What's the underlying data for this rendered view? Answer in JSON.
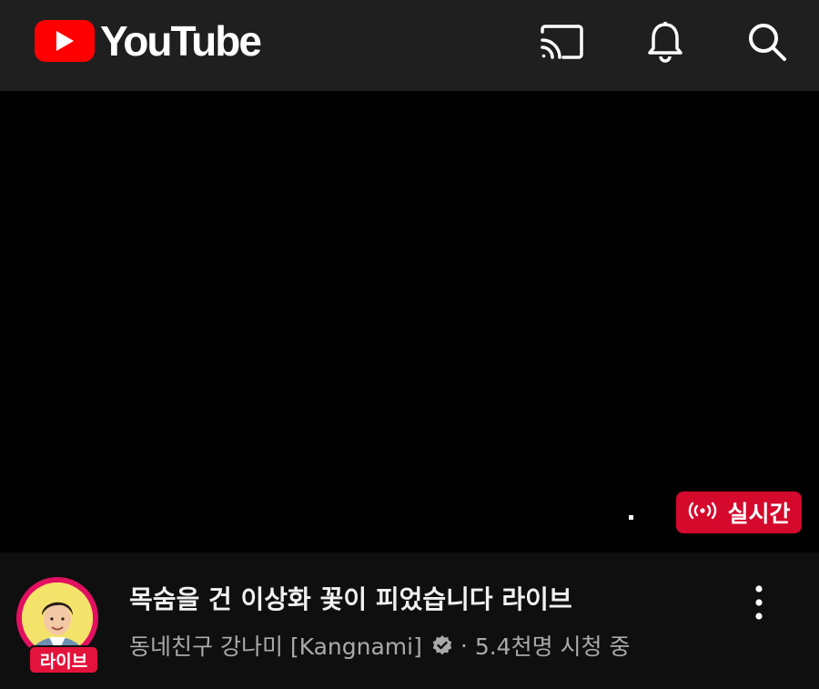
{
  "header": {
    "logo_text": "YouTube",
    "icons": [
      "cast-icon",
      "bell-icon",
      "search-icon"
    ]
  },
  "player": {
    "live_badge_label": "실시간",
    "live_badge_icon": "broadcast-icon"
  },
  "video": {
    "title": "목숨을 건 이상화 꽃이 피었습니다 라이브",
    "channel": "동네친구 강나미 [Kangnami]",
    "separator": "·",
    "viewers": "5.4천명 시청 중",
    "avatar_live_label": "라이브"
  },
  "colors": {
    "brand_red": "#ff0000",
    "live_red": "#d4092c",
    "topbar_bg": "#1f1f1f",
    "page_bg": "#0f0f0f"
  }
}
